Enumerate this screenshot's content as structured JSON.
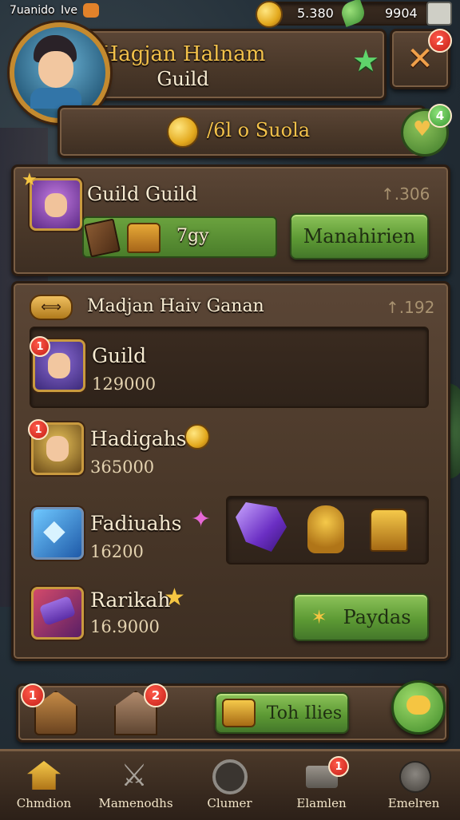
{
  "status_bar": {
    "time": "7uanido",
    "carrier": "Ive",
    "coins": "5.380",
    "gems": "9904"
  },
  "header": {
    "title_line1": "Hagjan Halnam",
    "title_line2": "Guild",
    "notif_badge": "2",
    "currency_value": "/6l o Suola",
    "currency_badge": "4"
  },
  "guild_card": {
    "title": "Guild Guild",
    "value": "↑.306",
    "bar_text": "7gy",
    "button_label": "Manahirien"
  },
  "list_panel": {
    "title": "Madjan Haiv Ganan",
    "value": "↑.192",
    "rows": [
      {
        "name": "Guild",
        "value": "129000",
        "badge": "1"
      },
      {
        "name": "Hadigahs",
        "value": "365000",
        "badge": "1"
      },
      {
        "name": "Fadiuahs",
        "value": "16200"
      },
      {
        "name": "Rarikah",
        "value": "16.9000",
        "button_label": "Paydas"
      }
    ]
  },
  "action_bar": {
    "badge_left": "1",
    "badge_mid": "2",
    "button_label": "Toh Ilies"
  },
  "bottom_nav": [
    {
      "label": "Chmdion"
    },
    {
      "label": "Mamenodhs"
    },
    {
      "label": "Clumer"
    },
    {
      "label": "Elamlen",
      "badge": "1"
    },
    {
      "label": "Emelren"
    }
  ],
  "colors": {
    "wood": "#4a3829",
    "green_button": "#5d9a34",
    "gold": "#e3a91e",
    "badge_red": "#c41e16"
  }
}
